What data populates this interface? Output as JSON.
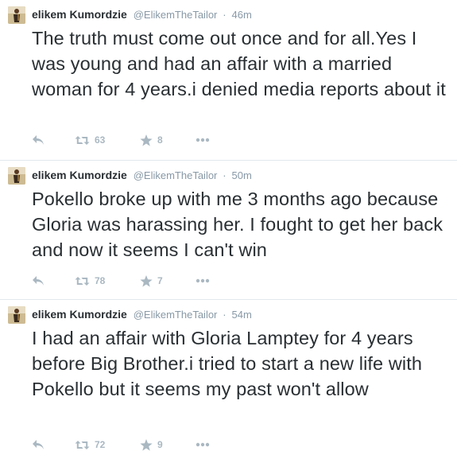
{
  "colors": {
    "text": "#292f33",
    "meta": "#8899a6",
    "action_icon": "#aab8c2",
    "divider": "#e1e8ed"
  },
  "tweets": [
    {
      "fullname": "elikem Kumordzie",
      "username": "@ElikemTheTailor",
      "dot": "·",
      "time": "46m",
      "text": "The truth must come out once and for all.Yes I was young and had an affair with a married woman for 4 years.i denied media reports about it",
      "retweets": "63",
      "favorites": "8",
      "icons": [
        "reply-icon",
        "retweet-icon",
        "favorite-icon",
        "more-icon"
      ]
    },
    {
      "fullname": "elikem Kumordzie",
      "username": "@ElikemTheTailor",
      "dot": "·",
      "time": "50m",
      "text": "Pokello broke up with me 3 months ago because Gloria was harassing her. I fought to get her back and now it seems  I can't win",
      "retweets": "78",
      "favorites": "7",
      "icons": [
        "reply-icon",
        "retweet-icon",
        "favorite-icon",
        "more-icon"
      ]
    },
    {
      "fullname": "elikem Kumordzie",
      "username": "@ElikemTheTailor",
      "dot": "·",
      "time": "54m",
      "text": "I had an affair with Gloria Lamptey for 4 years before Big Brother.i tried to start a new life with Pokello but it seems my past won't allow",
      "retweets": "72",
      "favorites": "9",
      "icons": [
        "reply-icon",
        "retweet-icon",
        "favorite-icon",
        "more-icon"
      ]
    }
  ]
}
